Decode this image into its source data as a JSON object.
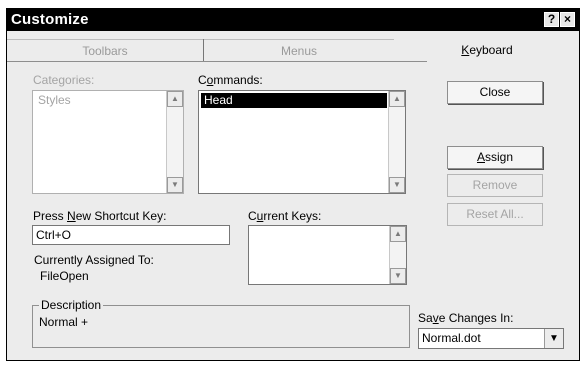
{
  "window": {
    "title": "Customize",
    "help_glyph": "?",
    "close_glyph": "×"
  },
  "tabs": [
    {
      "label": "Toolbars",
      "active": false
    },
    {
      "label": "Menus",
      "active": false
    },
    {
      "label": "Keyboard",
      "active": true,
      "mnemonic": "K"
    }
  ],
  "categories": {
    "label": "Categories:",
    "items": [
      "Styles"
    ]
  },
  "commands": {
    "label_pre": "C",
    "label_mn": "o",
    "label_post": "mmands:",
    "items": [
      "Head"
    ]
  },
  "shortcut": {
    "label_pre": "Press ",
    "label_mn": "N",
    "label_post": "ew Shortcut Key:",
    "value": "Ctrl+O"
  },
  "current_keys": {
    "label_pre": "C",
    "label_mn": "u",
    "label_post": "rrent Keys:"
  },
  "assigned": {
    "label": "Currently Assigned To:",
    "value": "FileOpen"
  },
  "description": {
    "legend": "Description",
    "text": "Normal +"
  },
  "buttons": {
    "close": "Close",
    "assign_mn": "A",
    "assign_rest": "ssign",
    "remove": "Remove",
    "reset_all": "Reset All..."
  },
  "save_changes": {
    "label_pre": "Sa",
    "label_mn": "v",
    "label_post": "e Changes In:",
    "value": "Normal.dot"
  },
  "icons": {
    "scroll_up": "▲",
    "scroll_down": "▼"
  }
}
